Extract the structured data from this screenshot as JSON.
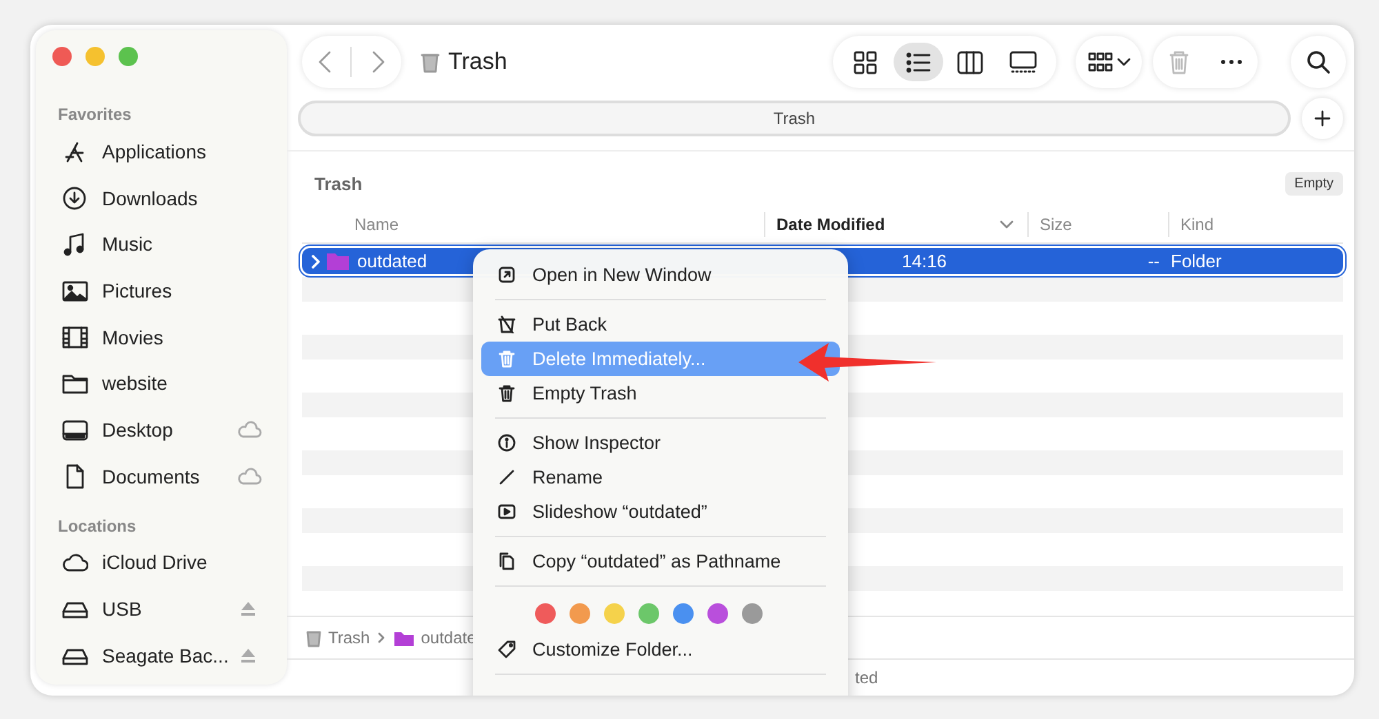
{
  "sidebar": {
    "sections": [
      {
        "heading": "Favorites",
        "items": [
          {
            "label": "Applications"
          },
          {
            "label": "Downloads"
          },
          {
            "label": "Music"
          },
          {
            "label": "Pictures"
          },
          {
            "label": "Movies"
          },
          {
            "label": "website"
          },
          {
            "label": "Desktop",
            "cloud": true
          },
          {
            "label": "Documents",
            "cloud": true
          }
        ]
      },
      {
        "heading": "Locations",
        "items": [
          {
            "label": "iCloud Drive"
          },
          {
            "label": "USB",
            "ejectable": true
          },
          {
            "label": "Seagate Bac...",
            "ejectable": true
          }
        ]
      }
    ]
  },
  "toolbar": {
    "title": "Trash",
    "views": [
      {
        "selected": false
      },
      {
        "selected": true
      },
      {
        "selected": false
      },
      {
        "selected": false
      }
    ]
  },
  "tabs": [
    {
      "label": "Trash"
    }
  ],
  "location_header": {
    "title": "Trash",
    "button": "Empty"
  },
  "table": {
    "columns": [
      {
        "label": "Name",
        "sorted": false
      },
      {
        "label": "Date Modified",
        "sorted": true
      },
      {
        "label": "Size",
        "sorted": false
      },
      {
        "label": "Kind",
        "sorted": false
      }
    ],
    "rows": [
      {
        "name": "outdated",
        "date": "14:16",
        "size": "--",
        "kind": "Folder",
        "selected": true
      }
    ]
  },
  "path_bar": [
    "Trash",
    "outdate"
  ],
  "status_bar": "ted",
  "context_menu": {
    "items": [
      {
        "kind": "item",
        "label": "Open in New Window",
        "selected": false
      },
      {
        "kind": "separator"
      },
      {
        "kind": "item",
        "label": "Put Back",
        "selected": false
      },
      {
        "kind": "item",
        "label": "Delete Immediately...",
        "selected": true
      },
      {
        "kind": "item",
        "label": "Empty Trash",
        "selected": false
      },
      {
        "kind": "separator"
      },
      {
        "kind": "item",
        "label": "Show Inspector",
        "selected": false
      },
      {
        "kind": "item",
        "label": "Rename",
        "selected": false
      },
      {
        "kind": "item",
        "label": "Slideshow “outdated”",
        "selected": false
      },
      {
        "kind": "separator"
      },
      {
        "kind": "item",
        "label": "Copy “outdated” as Pathname",
        "selected": false
      },
      {
        "kind": "separator"
      },
      {
        "kind": "tags",
        "tags": [
          {
            "color": "#ef5b5b"
          },
          {
            "color": "#f29a4e"
          },
          {
            "color": "#f5d24b"
          },
          {
            "color": "#6cc76a"
          },
          {
            "color": "#4a90f0"
          },
          {
            "color": "#b94fdc"
          },
          {
            "color": "#9a9a9a"
          }
        ]
      },
      {
        "kind": "item",
        "label": "Customize Folder...",
        "selected": false
      },
      {
        "kind": "separator"
      }
    ]
  }
}
